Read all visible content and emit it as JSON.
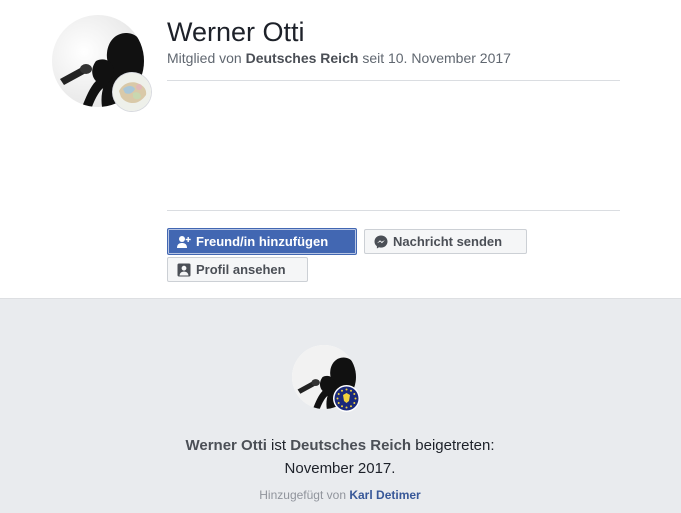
{
  "profile": {
    "name": "Werner Otti",
    "member_prefix": "Mitglied von",
    "group_name": "Deutsches Reich",
    "member_since": "seit 10. November 2017"
  },
  "actions": {
    "add_friend": "Freund/in hinzufügen",
    "send_message": "Nachricht senden",
    "view_profile": "Profil ansehen"
  },
  "joined_card": {
    "name": "Werner Otti",
    "verb": "ist",
    "group_name": "Deutsches Reich",
    "verb2": "beigetreten:",
    "date": "November 2017.",
    "added_by_prefix": "Hinzugefügt von",
    "added_by_name": "Karl Detimer"
  },
  "colors": {
    "primary": "#4267b2",
    "link": "#385898",
    "muted": "#90949c",
    "page_bg_bottom": "#e9ebee"
  },
  "icons": [
    "add-friend-icon",
    "messenger-icon",
    "profile-icon"
  ]
}
